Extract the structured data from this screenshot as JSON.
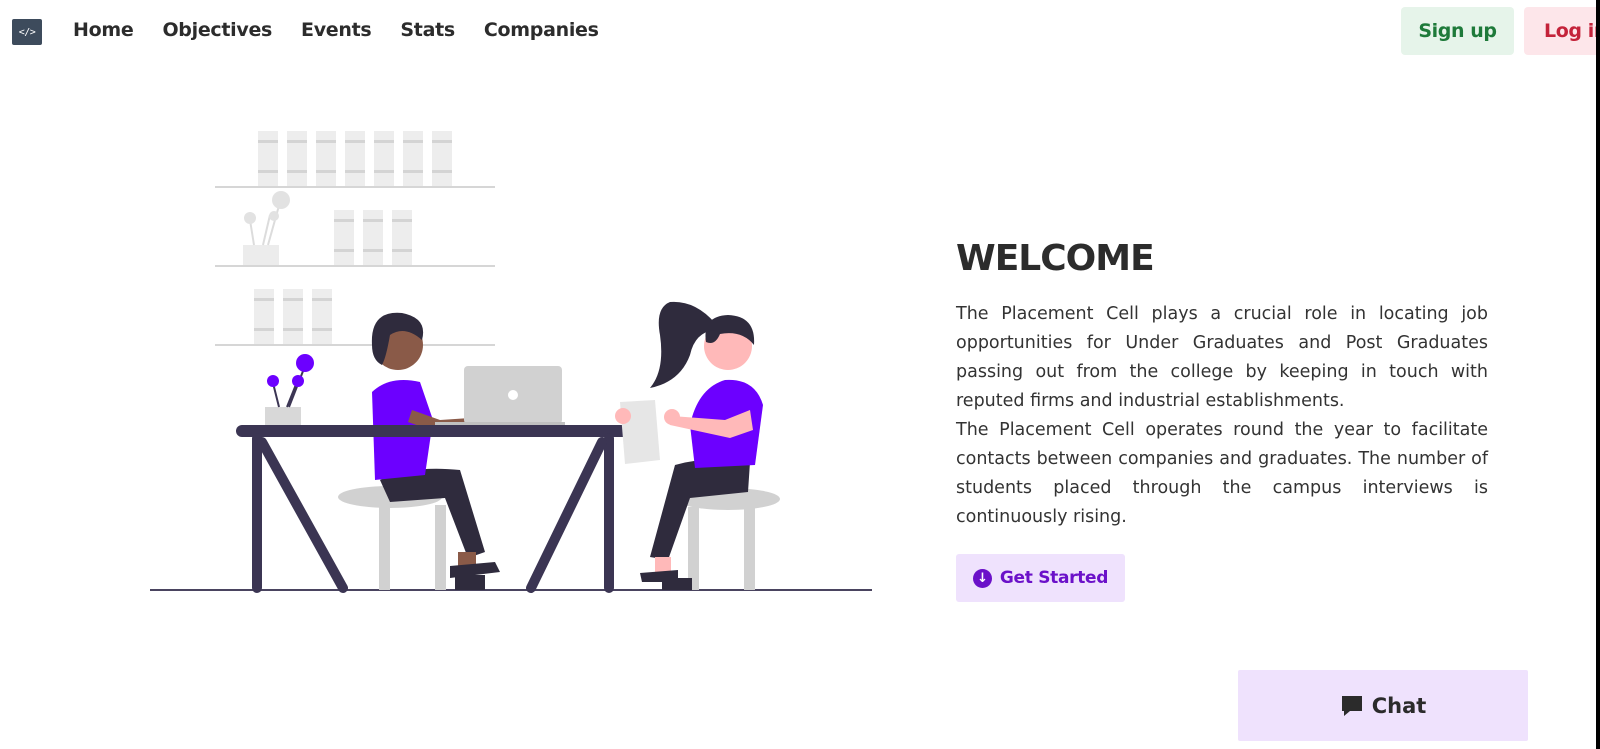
{
  "nav": {
    "logo_text": "</>",
    "links": [
      "Home",
      "Objectives",
      "Events",
      "Stats",
      "Companies"
    ],
    "signup_label": "Sign up",
    "login_label": "Log in"
  },
  "hero": {
    "title": "WELCOME",
    "paragraphs": [
      "The Placement Cell plays a crucial role in locating job opportunities for Under Graduates and Post Graduates passing out from the college by keeping in touch with reputed firms and industrial establishments.",
      "The Placement Cell operates round the year to facilitate contacts between companies and graduates. The number of students placed through the campus interviews is continuously rising."
    ],
    "cta_label": "Get Started",
    "cta_icon": "arrow-down-circle-icon"
  },
  "chat": {
    "label": "Chat",
    "icon": "chat-bubble-icon"
  },
  "colors": {
    "accent_purple": "#6c00ff",
    "accent_light": "#efe2fd",
    "signup_bg": "#e6f4ea",
    "signup_text": "#1e7a3a",
    "login_bg": "#fde6ea",
    "login_text": "#c4233a"
  }
}
